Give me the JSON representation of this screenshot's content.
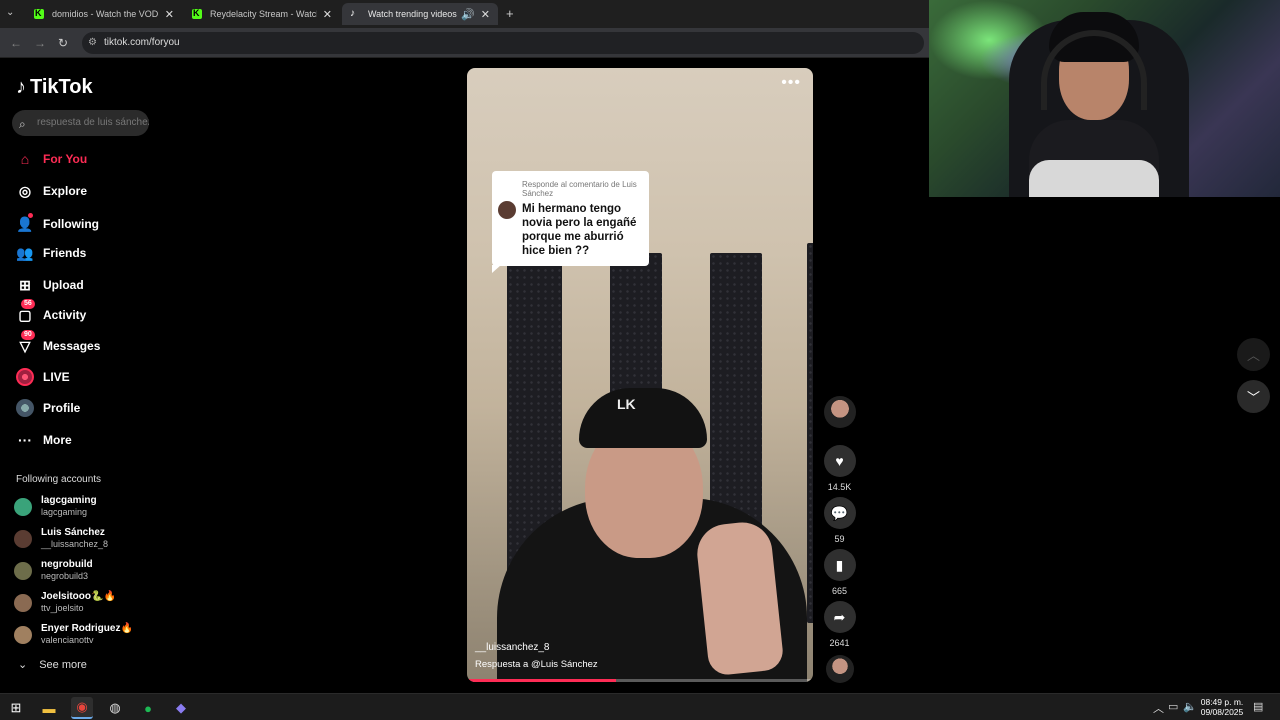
{
  "browser": {
    "tabs": [
      {
        "title": "domidios - Watch the VOD on Kick",
        "type": "kick",
        "active": false
      },
      {
        "title": "Reydelacity Stream - Watch Live on Kick",
        "type": "kick",
        "active": false
      },
      {
        "title": "Watch trending videos for you",
        "type": "tiktok",
        "active": true
      }
    ],
    "url": "tiktok.com/foryou",
    "new_tab_icon": "plus-icon"
  },
  "sidebar": {
    "logo_text": "TikTok",
    "search_placeholder": "respuesta de luis sánchez",
    "nav": [
      {
        "label": "For You",
        "icon": "home-icon",
        "active": true,
        "badge": ""
      },
      {
        "label": "Explore",
        "icon": "compass-icon",
        "active": false,
        "badge": ""
      },
      {
        "label": "Following",
        "icon": "following-icon",
        "active": false,
        "badge": ""
      },
      {
        "label": "Friends",
        "icon": "friends-icon",
        "active": false,
        "badge": ""
      },
      {
        "label": "Upload",
        "icon": "upload-icon",
        "active": false,
        "badge": ""
      },
      {
        "label": "Activity",
        "icon": "activity-icon",
        "active": false,
        "badge": "56"
      },
      {
        "label": "Messages",
        "icon": "messages-icon",
        "active": false,
        "badge": "90"
      },
      {
        "label": "LIVE",
        "icon": "live-icon",
        "active": false,
        "badge": ""
      },
      {
        "label": "Profile",
        "icon": "profile-avatar",
        "active": false,
        "badge": ""
      },
      {
        "label": "More",
        "icon": "more-icon",
        "active": false,
        "badge": ""
      }
    ],
    "following_title": "Following accounts",
    "accounts": [
      {
        "name": "lagcgaming",
        "handle": "lagcgaming",
        "color": "#3aa37a"
      },
      {
        "name": "Luis Sánchez",
        "handle": "__luissanchez_8",
        "color": "#5a3c32"
      },
      {
        "name": "negrobuild",
        "handle": "negrobuild3",
        "color": "#6d6d4a"
      },
      {
        "name": "Joelsitooo🐍🔥",
        "handle": "ttv_joelsito",
        "color": "#8a6a52"
      },
      {
        "name": "Enyer Rodriguez🔥",
        "handle": "valencianottv",
        "color": "#a08060"
      }
    ],
    "see_more": "See more"
  },
  "video": {
    "comment_reply_label": "Responde al comentario de Luis Sánchez",
    "comment_text": "Mi hermano tengo novia pero la engañé porque me aburrió hice bien ??",
    "username": "__luissanchez_8",
    "reply_caption": "Respuesta a @Luis Sánchez",
    "progress": 0.43
  },
  "actions": {
    "likes": "14.5K",
    "comments": "59",
    "saves": "665",
    "shares": "2641"
  },
  "taskbar": {
    "time": "08:49 p. m.",
    "date": "09/08/2025"
  },
  "colors": {
    "accent": "#fe2c55",
    "kick_green": "#53fc18"
  }
}
